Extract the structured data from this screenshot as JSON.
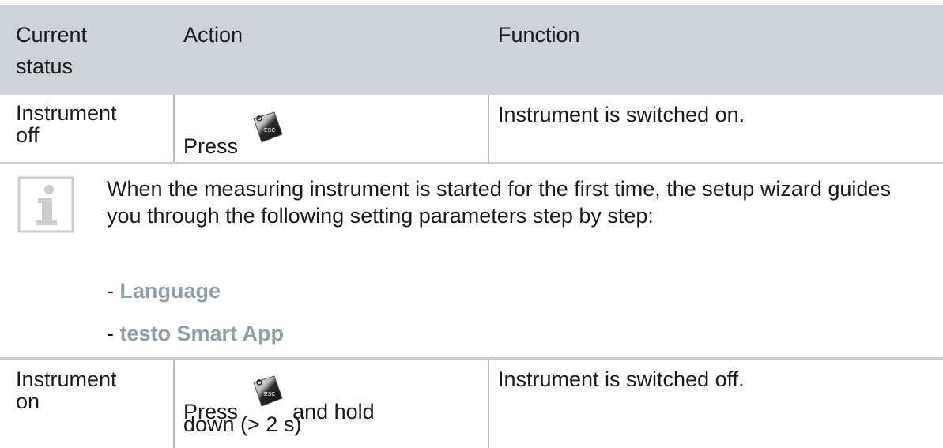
{
  "table": {
    "headers": [
      "Current status",
      "Action",
      "Function"
    ],
    "header_current_line1": "Current",
    "header_current_line2": "status",
    "rows": [
      {
        "status_line1": "Instrument",
        "status_line2": "off",
        "action_prefix": "Press",
        "action_key": "ESC",
        "function": "Instrument is switched on."
      },
      {
        "status_line1": "Instrument",
        "status_line2": "on",
        "action_prefix": "Press",
        "action_key": "ESC",
        "action_suffix": "and hold",
        "action_line2": "down (> 2 s)",
        "function": "Instrument is switched off."
      }
    ]
  },
  "note": {
    "icon": "info-icon",
    "text": "When the measuring instrument is started for the first time, the setup wizard guides you through the following setting parameters step by step:",
    "items": [
      {
        "prefix": "- ",
        "label": "Language"
      },
      {
        "prefix": "- ",
        "label": "testo Smart App"
      }
    ]
  },
  "colors": {
    "header_bg": "#cdd3d9",
    "highlight_text": "#8fa0ad",
    "icon_gray": "#c9ced3"
  }
}
